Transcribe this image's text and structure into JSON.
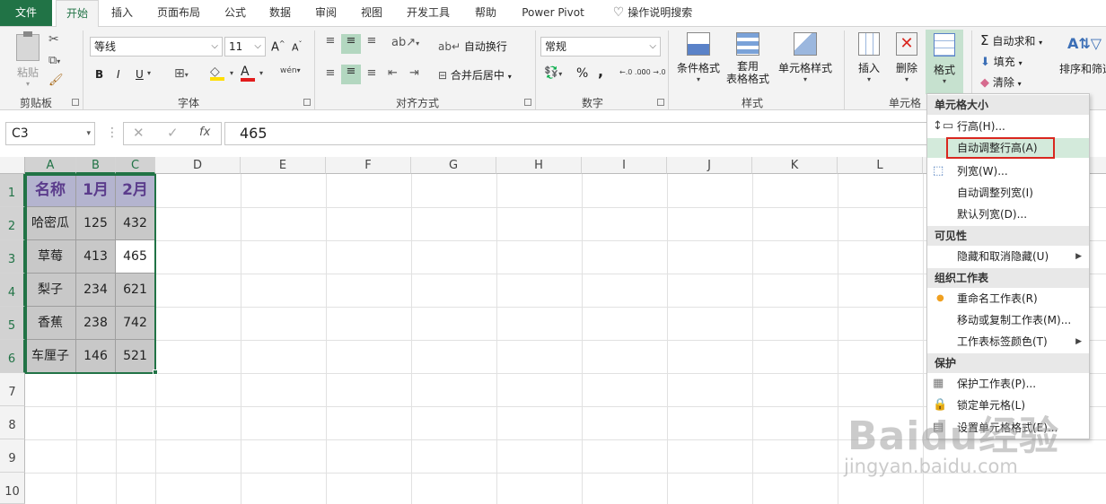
{
  "tabs": {
    "file": "文件",
    "home": "开始",
    "insert": "插入",
    "page_layout": "页面布局",
    "formulas": "公式",
    "data": "数据",
    "review": "审阅",
    "view": "视图",
    "developer": "开发工具",
    "help": "帮助",
    "power_pivot": "Power Pivot",
    "tell_me": "操作说明搜索"
  },
  "clipboard": {
    "paste": "粘贴",
    "group": "剪贴板"
  },
  "font": {
    "name": "等线",
    "size": "11",
    "bold": "B",
    "italic": "I",
    "underline": "U",
    "phonetic": "wén",
    "grow": "A",
    "shrink": "A",
    "group": "字体"
  },
  "alignment": {
    "wrap": "自动换行",
    "merge": "合并后居中",
    "group": "对齐方式"
  },
  "number": {
    "format": "常规",
    "percent": "%",
    "comma": ",",
    "inc_dec": "←.0 .00",
    "dec_dec": ".00 →.0",
    "group": "数字"
  },
  "styles": {
    "conditional": "条件格式",
    "as_table_1": "套用",
    "as_table_2": "表格格式",
    "cell_styles": "单元格样式",
    "group": "样式"
  },
  "cells": {
    "insert": "插入",
    "delete": "删除",
    "format": "格式",
    "group": "单元格"
  },
  "editing": {
    "autosum": "自动求和",
    "fill": "填充",
    "clear": "清除",
    "sort": "排序和筛选"
  },
  "formula_bar": {
    "name_box": "C3",
    "cancel": "✕",
    "enter": "✓",
    "fx": "fx",
    "value": "465"
  },
  "columns": [
    "A",
    "B",
    "C",
    "D",
    "E",
    "F",
    "G",
    "H",
    "I",
    "J",
    "K",
    "L"
  ],
  "rows": [
    "1",
    "2",
    "3",
    "4",
    "5",
    "6",
    "7",
    "8",
    "9",
    "10"
  ],
  "table": {
    "header": [
      "名称",
      "1月",
      "2月"
    ],
    "rows": [
      [
        "哈密瓜",
        "125",
        "432"
      ],
      [
        "草莓",
        "413",
        "465"
      ],
      [
        "梨子",
        "234",
        "621"
      ],
      [
        "香蕉",
        "238",
        "742"
      ],
      [
        "车厘子",
        "146",
        "521"
      ]
    ]
  },
  "menu": {
    "sec_size": "单元格大小",
    "row_height": "行高(H)...",
    "autofit_row": "自动调整行高(A)",
    "col_width": "列宽(W)...",
    "autofit_col": "自动调整列宽(I)",
    "default_width": "默认列宽(D)...",
    "sec_visibility": "可见性",
    "hide_unhide": "隐藏和取消隐藏(U)",
    "sec_organize": "组织工作表",
    "rename": "重命名工作表(R)",
    "move_copy": "移动或复制工作表(M)...",
    "tab_color": "工作表标签颜色(T)",
    "sec_protect": "保护",
    "protect_sheet": "保护工作表(P)...",
    "lock_cell": "锁定单元格(L)",
    "format_cells": "设置单元格格式(E)..."
  },
  "watermark": {
    "brand": "Baidu经验",
    "url": "jingyan.baidu.com"
  },
  "colors": {
    "accent": "#217346",
    "header_fill": "#b4b4cf",
    "header_text": "#5b3c8c",
    "data_fill": "#c8c8c8",
    "highlight": "#d9271f"
  }
}
